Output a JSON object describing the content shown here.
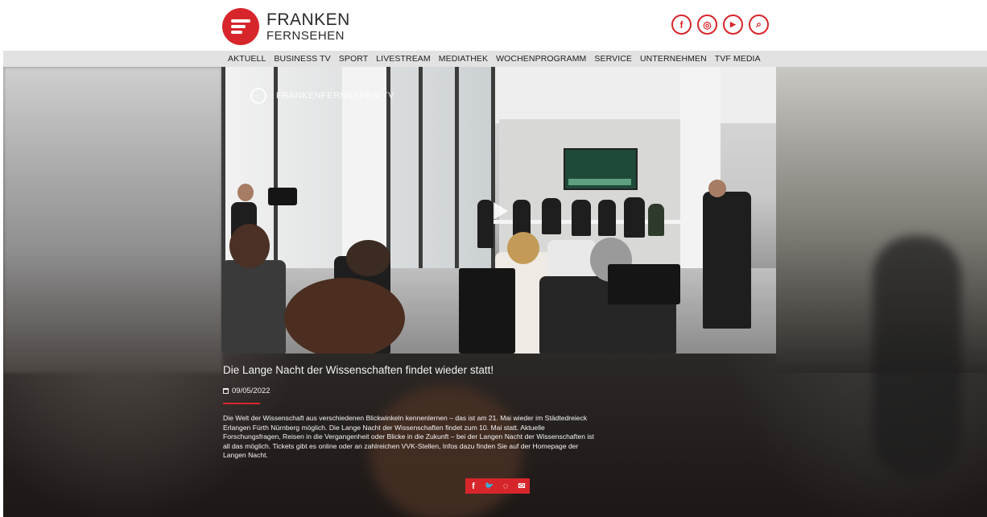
{
  "header": {
    "logo_line1": "FRANKEN",
    "logo_line2": "FERNSEHEN",
    "social": [
      {
        "icon": "facebook-icon",
        "glyph": "f"
      },
      {
        "icon": "instagram-icon",
        "glyph": "◎"
      },
      {
        "icon": "youtube-icon",
        "glyph": "▶"
      },
      {
        "icon": "search-icon",
        "glyph": "⌕"
      }
    ]
  },
  "nav": {
    "items": [
      "AKTUELL",
      "BUSINESS TV",
      "SPORT",
      "LIVESTREAM",
      "MEDIATHEK",
      "WOCHENPROGRAMM",
      "SERVICE",
      "UNTERNEHMEN",
      "TVF MEDIA"
    ]
  },
  "video": {
    "watermark": "FRANKENFERNSEHEN.TV"
  },
  "article": {
    "title": "Die Lange Nacht der Wissenschaften findet wieder statt!",
    "date": "09/05/2022",
    "body": "Die Welt der Wissenschaft aus verschiedenen Blickwinkeln kennenlernen – das ist am 21. Mai wieder im Städtedreieck Erlangen Fürth Nürnberg möglich. Die Lange Nacht der Wissenschaften findet zum 10. Mai statt.  Aktuelle Forschungsfragen, Reisen in die Vergangenheit oder Blicke in die Zukunft – bei der Langen Nacht der Wissenschaften ist all das möglich. Tickets gibt es online oder an zahlreichen VVK-Stellen, Infos dazu finden Sie auf der Homepage der Langen Nacht."
  },
  "share": [
    {
      "icon": "facebook-icon",
      "glyph": "f"
    },
    {
      "icon": "twitter-icon",
      "glyph": "🐦"
    },
    {
      "icon": "whatsapp-icon",
      "glyph": "◌"
    },
    {
      "icon": "mail-icon",
      "glyph": "✉"
    }
  ],
  "colors": {
    "brand_red": "#d7262b",
    "nav_bg": "#e2e2e2"
  }
}
